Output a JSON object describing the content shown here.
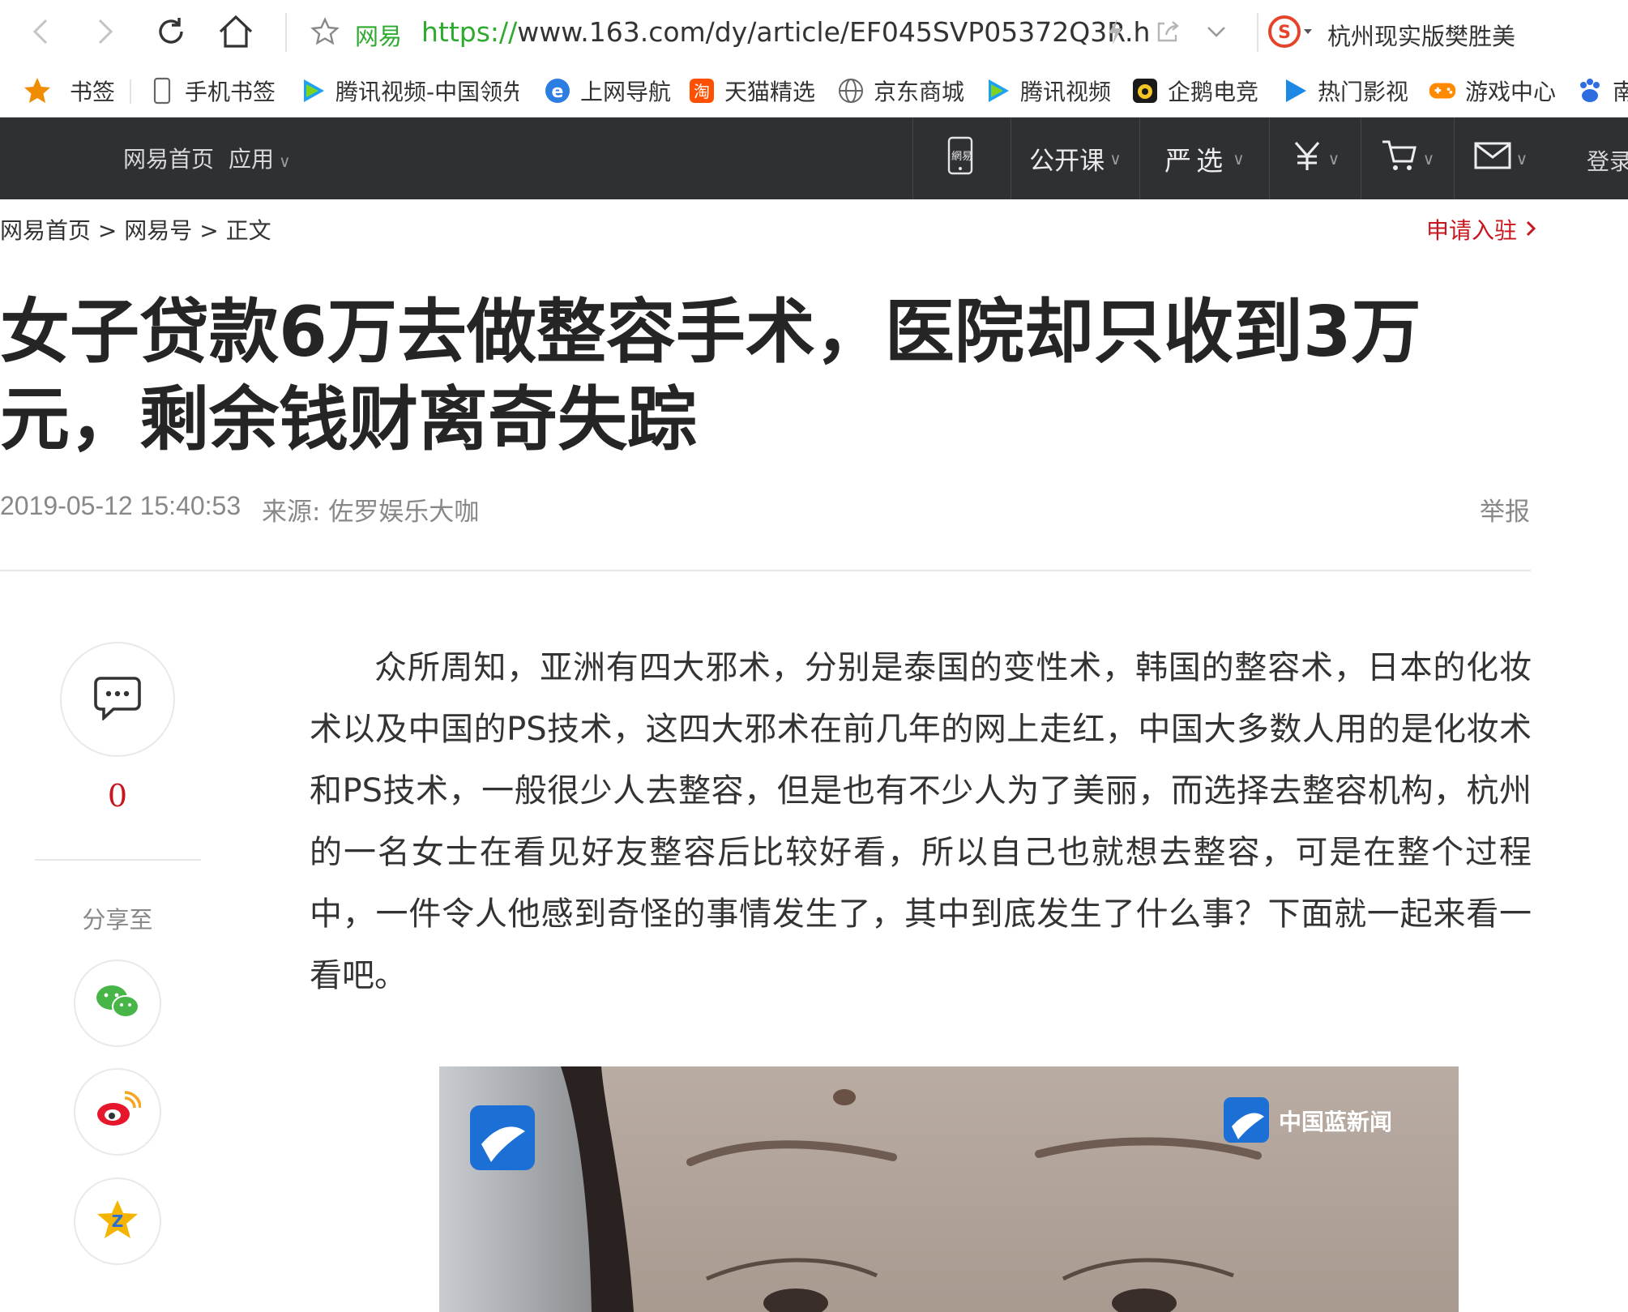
{
  "browser": {
    "site_label": "网易",
    "url_scheme": "https://",
    "url_rest": "www.163.com/dy/article/EF045SVP05372Q3R.h",
    "search_text": "杭州现实版樊胜美"
  },
  "bookmarks": [
    {
      "label": "书签",
      "icon": "star-icon"
    },
    {
      "label": "手机书签",
      "icon": "phone-icon"
    },
    {
      "label": "腾讯视频-中国领先",
      "icon": "tencent-video-icon"
    },
    {
      "label": "上网导航",
      "icon": "ie-icon"
    },
    {
      "label": "天猫精选",
      "icon": "taobao-icon"
    },
    {
      "label": "京东商城",
      "icon": "globe-icon"
    },
    {
      "label": "腾讯视频",
      "icon": "tencent-video-icon"
    },
    {
      "label": "企鹅电竞",
      "icon": "penguin-esports-icon"
    },
    {
      "label": "热门影视",
      "icon": "play-icon"
    },
    {
      "label": "游戏中心",
      "icon": "gamepad-icon"
    },
    {
      "label": "南",
      "icon": "baidu-icon"
    }
  ],
  "topnav": {
    "home": "网易首页",
    "apps": "应用",
    "open_course": "公开课",
    "yanxuan": "严选",
    "login": "登录"
  },
  "breadcrumb": {
    "home": "网易首页",
    "sep1": ">",
    "dy": "网易号",
    "sep2": ">",
    "current": "正文"
  },
  "apply_link": "申请入驻",
  "article": {
    "title": "女子贷款6万去做整容手术，医院却只收到3万元，剩余钱财离奇失踪",
    "date": "2019-05-12 15:40:53",
    "source": "来源: 佐罗娱乐大咖",
    "report": "举报",
    "body": "众所周知，亚洲有四大邪术，分别是泰国的变性术，韩国的整容术，日本的化妆术以及中国的PS技术，这四大邪术在前几年的网上走红，中国大多数人用的是化妆术和PS技术，一般很少人去整容，但是也有不少人为了美丽，而选择去整容机构，杭州的一名女士在看见好友整容后比较好看，所以自己也就想去整容，可是在整个过程中，一件令人他感到奇怪的事情发生了，其中到底发生了什么事？下面就一起来看一看吧。"
  },
  "sidebar": {
    "comment_count": "0",
    "share_label": "分享至",
    "share_targets": [
      "wechat-icon",
      "weibo-icon",
      "qzone-icon"
    ]
  },
  "image_overlay": {
    "channel_logo_text": "中国蓝新闻"
  }
}
